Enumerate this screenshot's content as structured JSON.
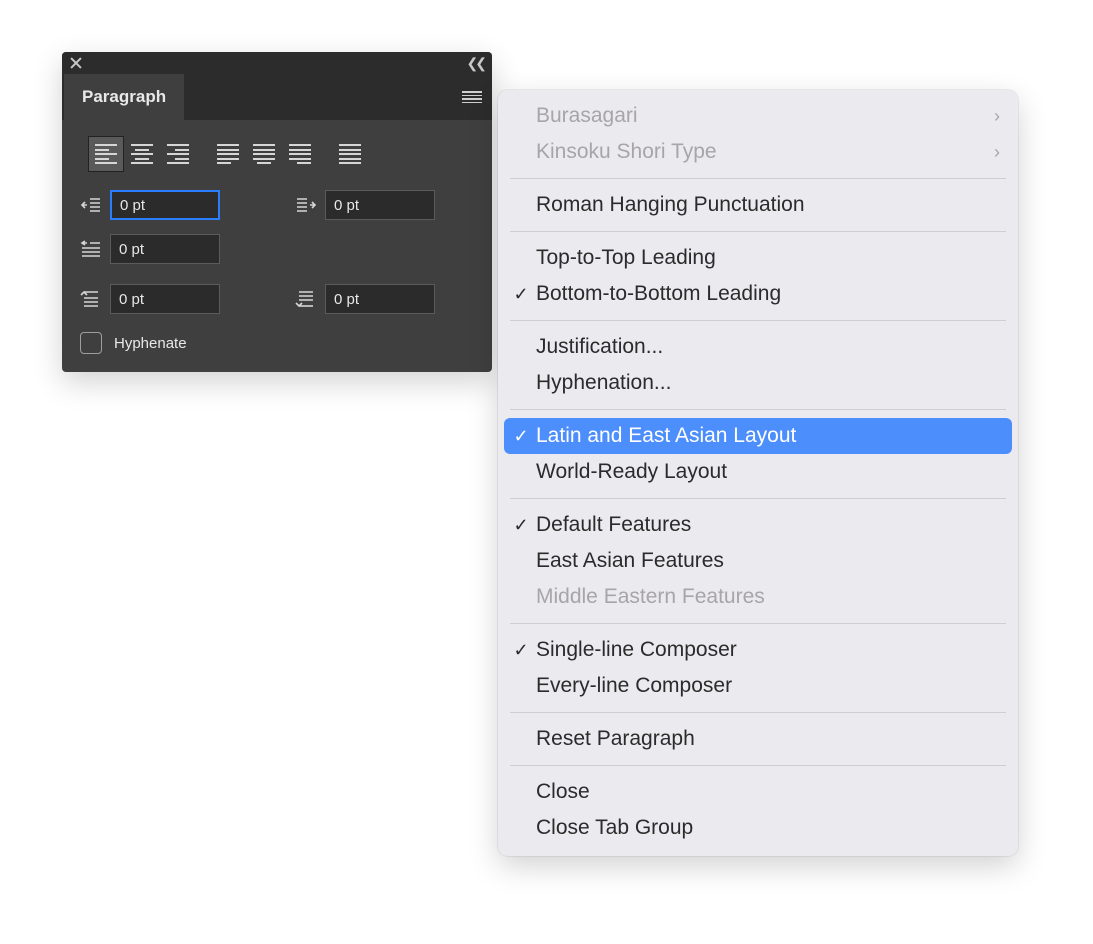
{
  "panel": {
    "tab_label": "Paragraph",
    "fields": {
      "indent_left": {
        "value": "0 pt"
      },
      "indent_right": {
        "value": "0 pt"
      },
      "first_line": {
        "value": "0 pt"
      },
      "space_before": {
        "value": "0 pt"
      },
      "space_after": {
        "value": "0 pt"
      }
    },
    "hyphenate_label": "Hyphenate",
    "hyphenate_checked": false,
    "alignment": {
      "selected": "left"
    }
  },
  "menu": {
    "burasagari": {
      "label": "Burasagari",
      "disabled": true,
      "checked": false,
      "submenu": true
    },
    "kinsoku": {
      "label": "Kinsoku Shori Type",
      "disabled": true,
      "checked": false,
      "submenu": true
    },
    "roman_hanging": {
      "label": "Roman Hanging Punctuation",
      "disabled": false,
      "checked": false
    },
    "top_leading": {
      "label": "Top-to-Top Leading",
      "disabled": false,
      "checked": false
    },
    "bottom_leading": {
      "label": "Bottom-to-Bottom Leading",
      "disabled": false,
      "checked": true
    },
    "justification": {
      "label": "Justification...",
      "disabled": false,
      "checked": false
    },
    "hyphenation": {
      "label": "Hyphenation...",
      "disabled": false,
      "checked": false
    },
    "latin_layout": {
      "label": "Latin and East Asian Layout",
      "disabled": false,
      "checked": true,
      "highlight": true
    },
    "world_layout": {
      "label": "World-Ready Layout",
      "disabled": false,
      "checked": false
    },
    "default_features": {
      "label": "Default Features",
      "disabled": false,
      "checked": true
    },
    "east_asian": {
      "label": "East Asian Features",
      "disabled": false,
      "checked": false
    },
    "middle_eastern": {
      "label": "Middle Eastern Features",
      "disabled": true,
      "checked": false
    },
    "single_composer": {
      "label": "Single-line Composer",
      "disabled": false,
      "checked": true
    },
    "every_composer": {
      "label": "Every-line Composer",
      "disabled": false,
      "checked": false
    },
    "reset": {
      "label": "Reset Paragraph",
      "disabled": false,
      "checked": false
    },
    "close": {
      "label": "Close",
      "disabled": false,
      "checked": false
    },
    "close_group": {
      "label": "Close Tab Group",
      "disabled": false,
      "checked": false
    }
  }
}
